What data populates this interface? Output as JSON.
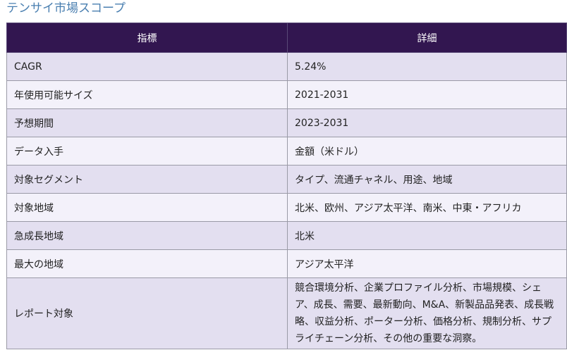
{
  "page": {
    "title": "テンサイ市場スコープ"
  },
  "table": {
    "headers": [
      "指標",
      "詳細"
    ],
    "rows": [
      {
        "metric": "CAGR",
        "detail": "5.24%"
      },
      {
        "metric": "年使用可能サイズ",
        "detail": "2021-2031"
      },
      {
        "metric": "予想期間",
        "detail": "2023-2031"
      },
      {
        "metric": "データ入手",
        "detail": "金額（米ドル）"
      },
      {
        "metric": "対象セグメント",
        "detail": "タイプ、流通チャネル、用途、地域"
      },
      {
        "metric": "対象地域",
        "detail": "北米、欧州、アジア太平洋、南米、中東・アフリカ"
      },
      {
        "metric": "急成長地域",
        "detail": "北米"
      },
      {
        "metric": "最大の地域",
        "detail": "アジア太平洋"
      },
      {
        "metric": "レポート対象",
        "detail": "競合環境分析、企業プロファイル分析、市場規模、シェア、成長、需要、最新動向、M&A、新製品品発表、成長戦略、収益分析、ポーター分析、価格分析、規制分析、サプライチェーン分析、その他の重要な洞察。"
      }
    ]
  },
  "colors": {
    "title": "#4a7fb0",
    "header_bg": "#321650",
    "header_text": "#ffffff",
    "row_odd": "#e3dff0",
    "row_even": "#f3f1fa",
    "border": "#9a9aa6"
  }
}
